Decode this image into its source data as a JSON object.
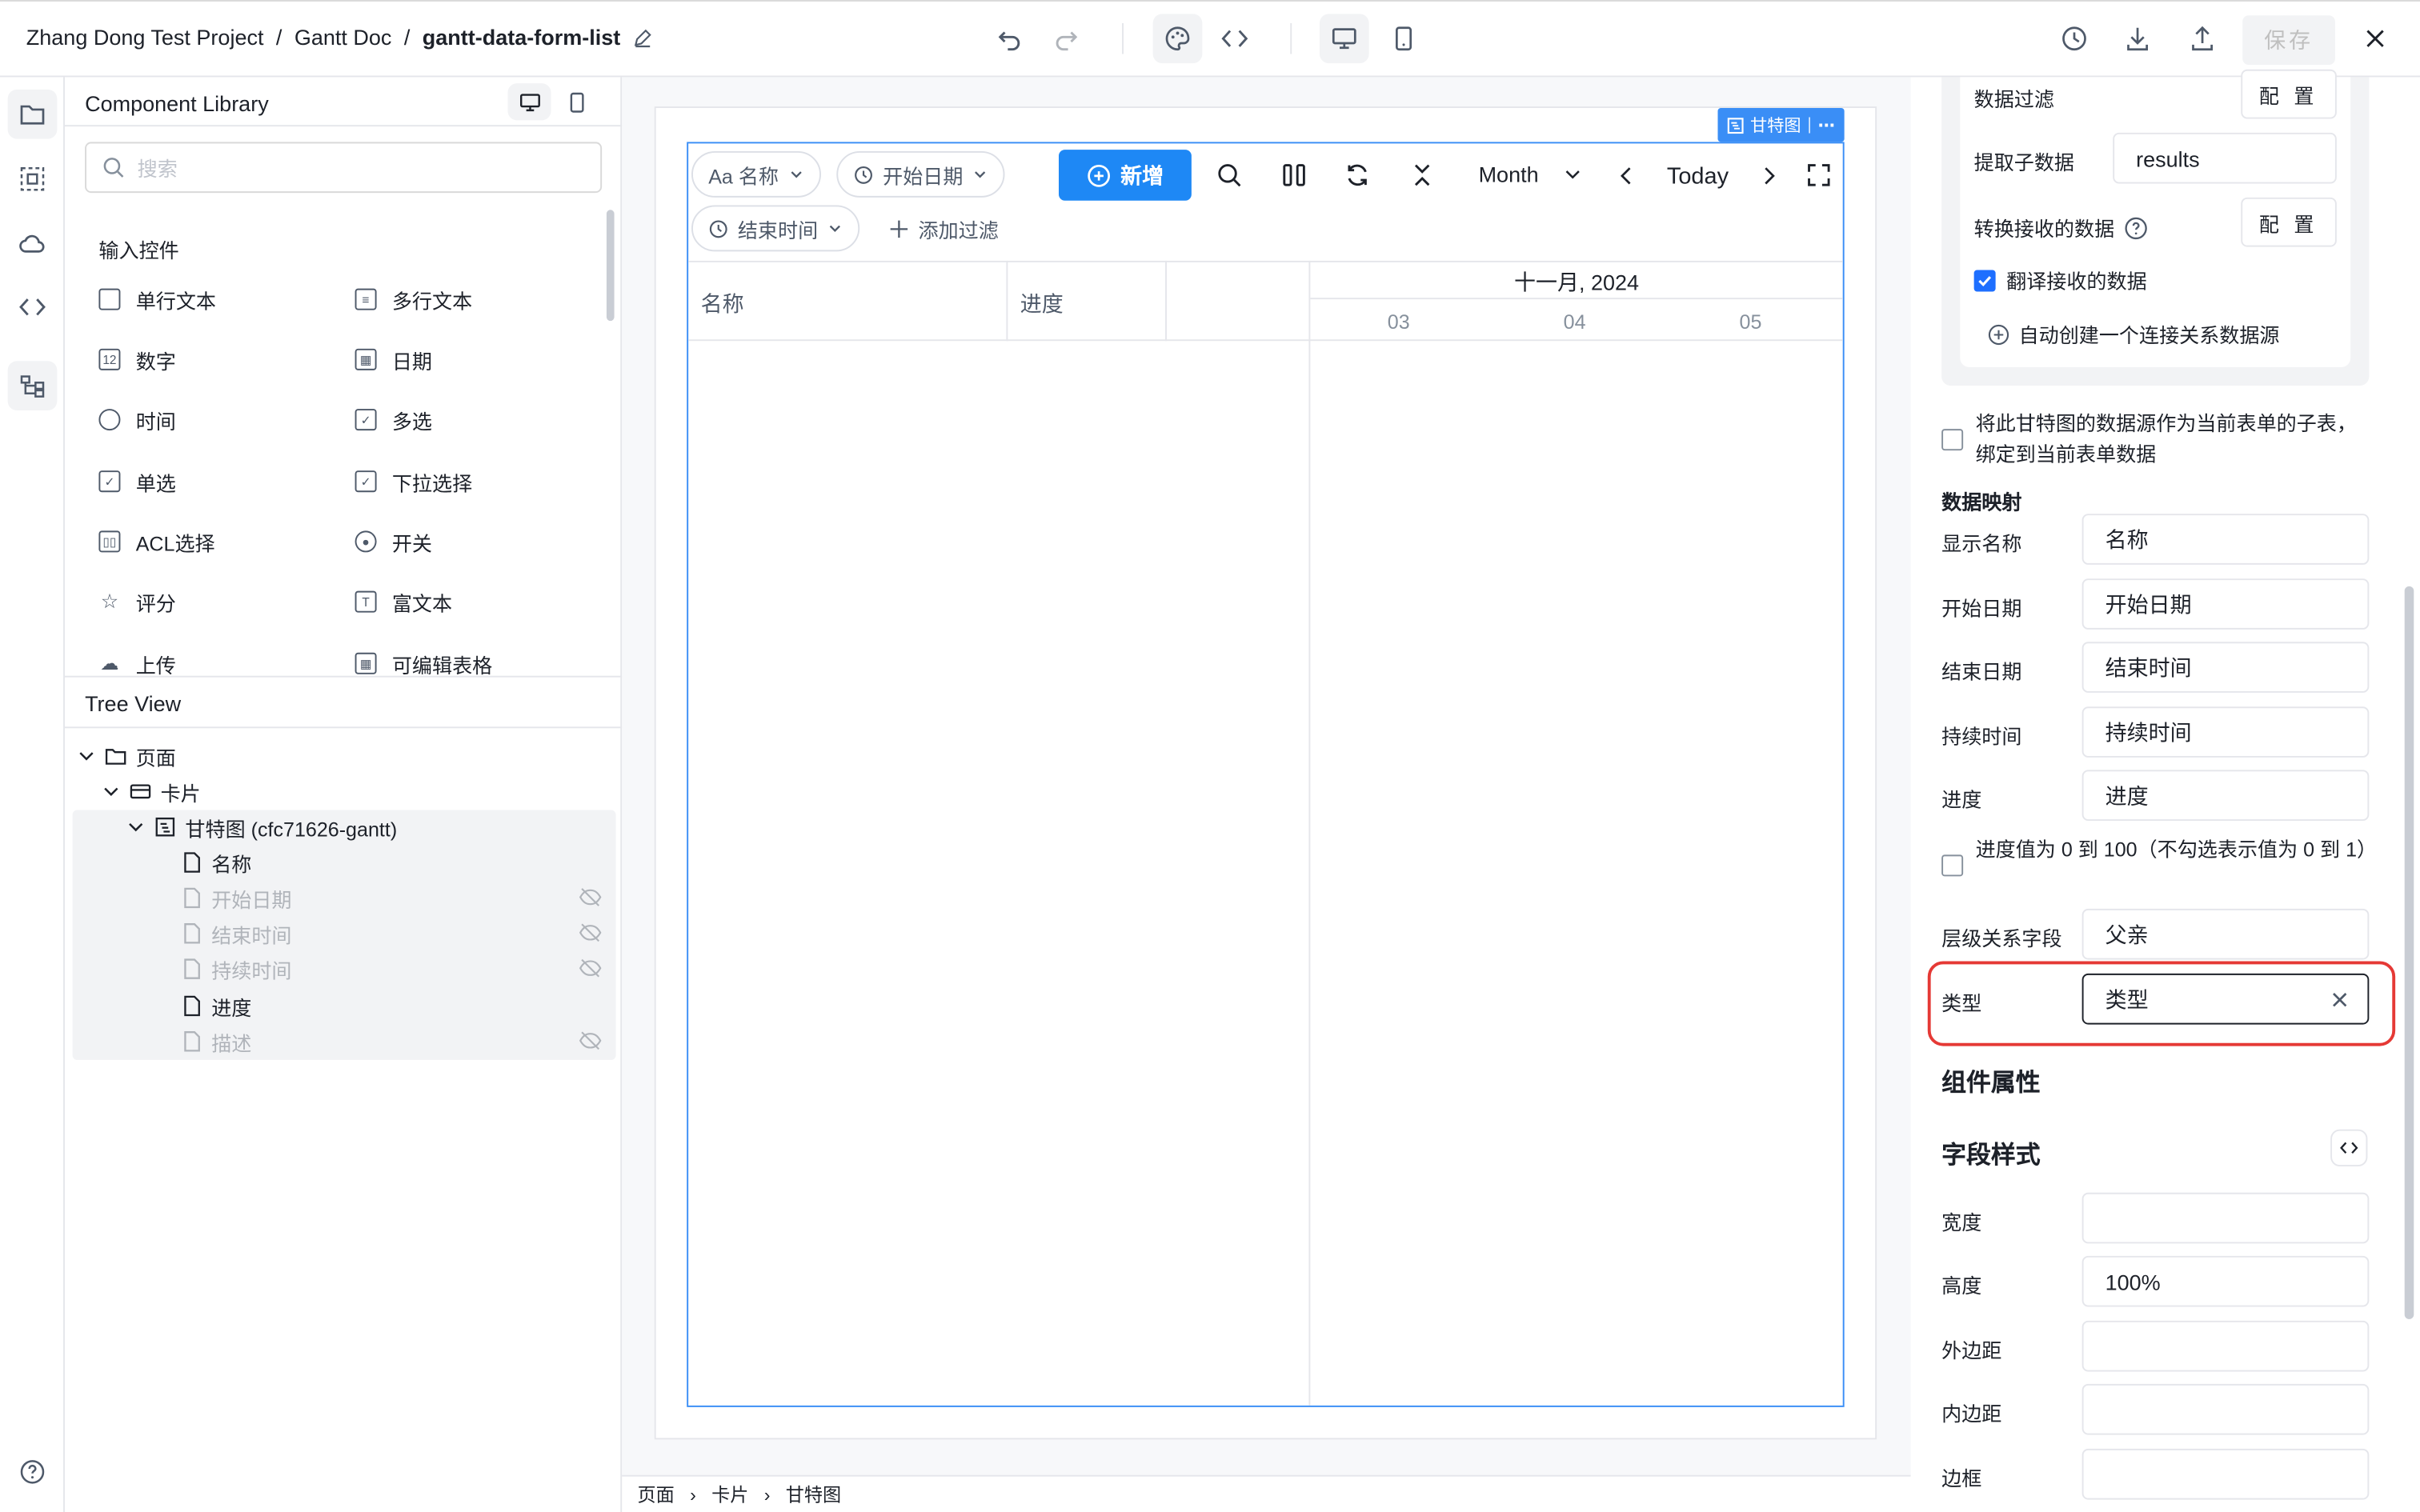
{
  "topbar": {
    "breadcrumb": [
      "Zhang Dong Test Project",
      "Gantt Doc",
      "gantt-data-form-list"
    ],
    "separator": "/",
    "save_label": "保存",
    "icons": [
      "undo-icon",
      "redo-icon",
      "palette-icon",
      "code-icon",
      "desktop-icon",
      "mobile-icon",
      "history-icon",
      "download-icon",
      "upload-icon",
      "close-icon"
    ]
  },
  "component_library": {
    "title": "Component Library",
    "search_placeholder": "搜索",
    "section_title": "输入控件",
    "controls": [
      {
        "label": "单行文本",
        "icon": "single-line-text-icon"
      },
      {
        "label": "多行文本",
        "icon": "multi-line-text-icon"
      },
      {
        "label": "数字",
        "icon": "number-icon"
      },
      {
        "label": "日期",
        "icon": "date-icon"
      },
      {
        "label": "时间",
        "icon": "time-icon"
      },
      {
        "label": "多选",
        "icon": "multi-select-icon"
      },
      {
        "label": "单选",
        "icon": "single-select-icon"
      },
      {
        "label": "下拉选择",
        "icon": "dropdown-icon"
      },
      {
        "label": "ACL选择",
        "icon": "acl-icon"
      },
      {
        "label": "开关",
        "icon": "switch-icon"
      },
      {
        "label": "评分",
        "icon": "rating-icon"
      },
      {
        "label": "富文本",
        "icon": "rich-text-icon"
      },
      {
        "label": "上传",
        "icon": "upload-icon"
      },
      {
        "label": "可编辑表格",
        "icon": "editable-table-icon"
      }
    ]
  },
  "tree_view": {
    "title": "Tree View",
    "nodes": [
      {
        "label": "页面",
        "level": 0,
        "icon": "folder-icon",
        "dim": false,
        "hidden": false
      },
      {
        "label": "卡片",
        "level": 1,
        "icon": "card-icon",
        "dim": false,
        "hidden": false
      },
      {
        "label": "甘特图 (cfc71626-gantt)",
        "level": 2,
        "icon": "gantt-icon",
        "dim": false,
        "hidden": false
      },
      {
        "label": "名称",
        "level": 3,
        "icon": "file-icon",
        "dim": false,
        "hidden": false
      },
      {
        "label": "开始日期",
        "level": 3,
        "icon": "file-icon",
        "dim": true,
        "hidden": true
      },
      {
        "label": "结束时间",
        "level": 3,
        "icon": "file-icon",
        "dim": true,
        "hidden": true
      },
      {
        "label": "持续时间",
        "level": 3,
        "icon": "file-icon",
        "dim": true,
        "hidden": true
      },
      {
        "label": "进度",
        "level": 3,
        "icon": "file-icon",
        "dim": false,
        "hidden": false
      },
      {
        "label": "描述",
        "level": 3,
        "icon": "file-icon",
        "dim": true,
        "hidden": true
      }
    ]
  },
  "gantt": {
    "badge": "甘特图",
    "filters": {
      "name": "Aa 名称",
      "start": "开始日期",
      "end": "结束时间",
      "add": "添加过滤"
    },
    "new_button": "新增",
    "view_mode": "Month",
    "today_label": "Today",
    "columns": [
      "名称",
      "进度"
    ],
    "month_title": "十一月, 2024",
    "days": [
      "03",
      "04",
      "05"
    ]
  },
  "footer_breadcrumb": [
    "页面",
    "卡片",
    "甘特图"
  ],
  "properties": {
    "data_filter": {
      "label": "数据过滤",
      "button": "配 置"
    },
    "extract_children": {
      "label": "提取子数据",
      "value": "results"
    },
    "transform_received": {
      "label": "转换接收的数据",
      "button": "配 置"
    },
    "translate_received": {
      "label": "翻译接收的数据",
      "checked": true
    },
    "auto_create": "自动创建一个连接关系数据源",
    "subtable_option": "将此甘特图的数据源作为当前表单的子表，绑定到当前表单数据",
    "mapping_title": "数据映射",
    "mapping": [
      {
        "label": "显示名称",
        "value": "名称"
      },
      {
        "label": "开始日期",
        "value": "开始日期"
      },
      {
        "label": "结束日期",
        "value": "结束时间"
      },
      {
        "label": "持续时间",
        "value": "持续时间"
      },
      {
        "label": "进度",
        "value": "进度"
      }
    ],
    "progress_option": "进度值为 0 到 100（不勾选表示值为 0 到 1）",
    "hierarchy": {
      "label": "层级关系字段",
      "value": "父亲"
    },
    "type": {
      "label": "类型",
      "value": "类型"
    },
    "component_props_title": "组件属性",
    "field_style_title": "字段样式",
    "style_fields": [
      {
        "label": "宽度",
        "value": ""
      },
      {
        "label": "高度",
        "value": "100%"
      },
      {
        "label": "外边距",
        "value": ""
      },
      {
        "label": "内边距",
        "value": ""
      },
      {
        "label": "边框",
        "value": ""
      }
    ],
    "highlight_color": "#e53935"
  }
}
